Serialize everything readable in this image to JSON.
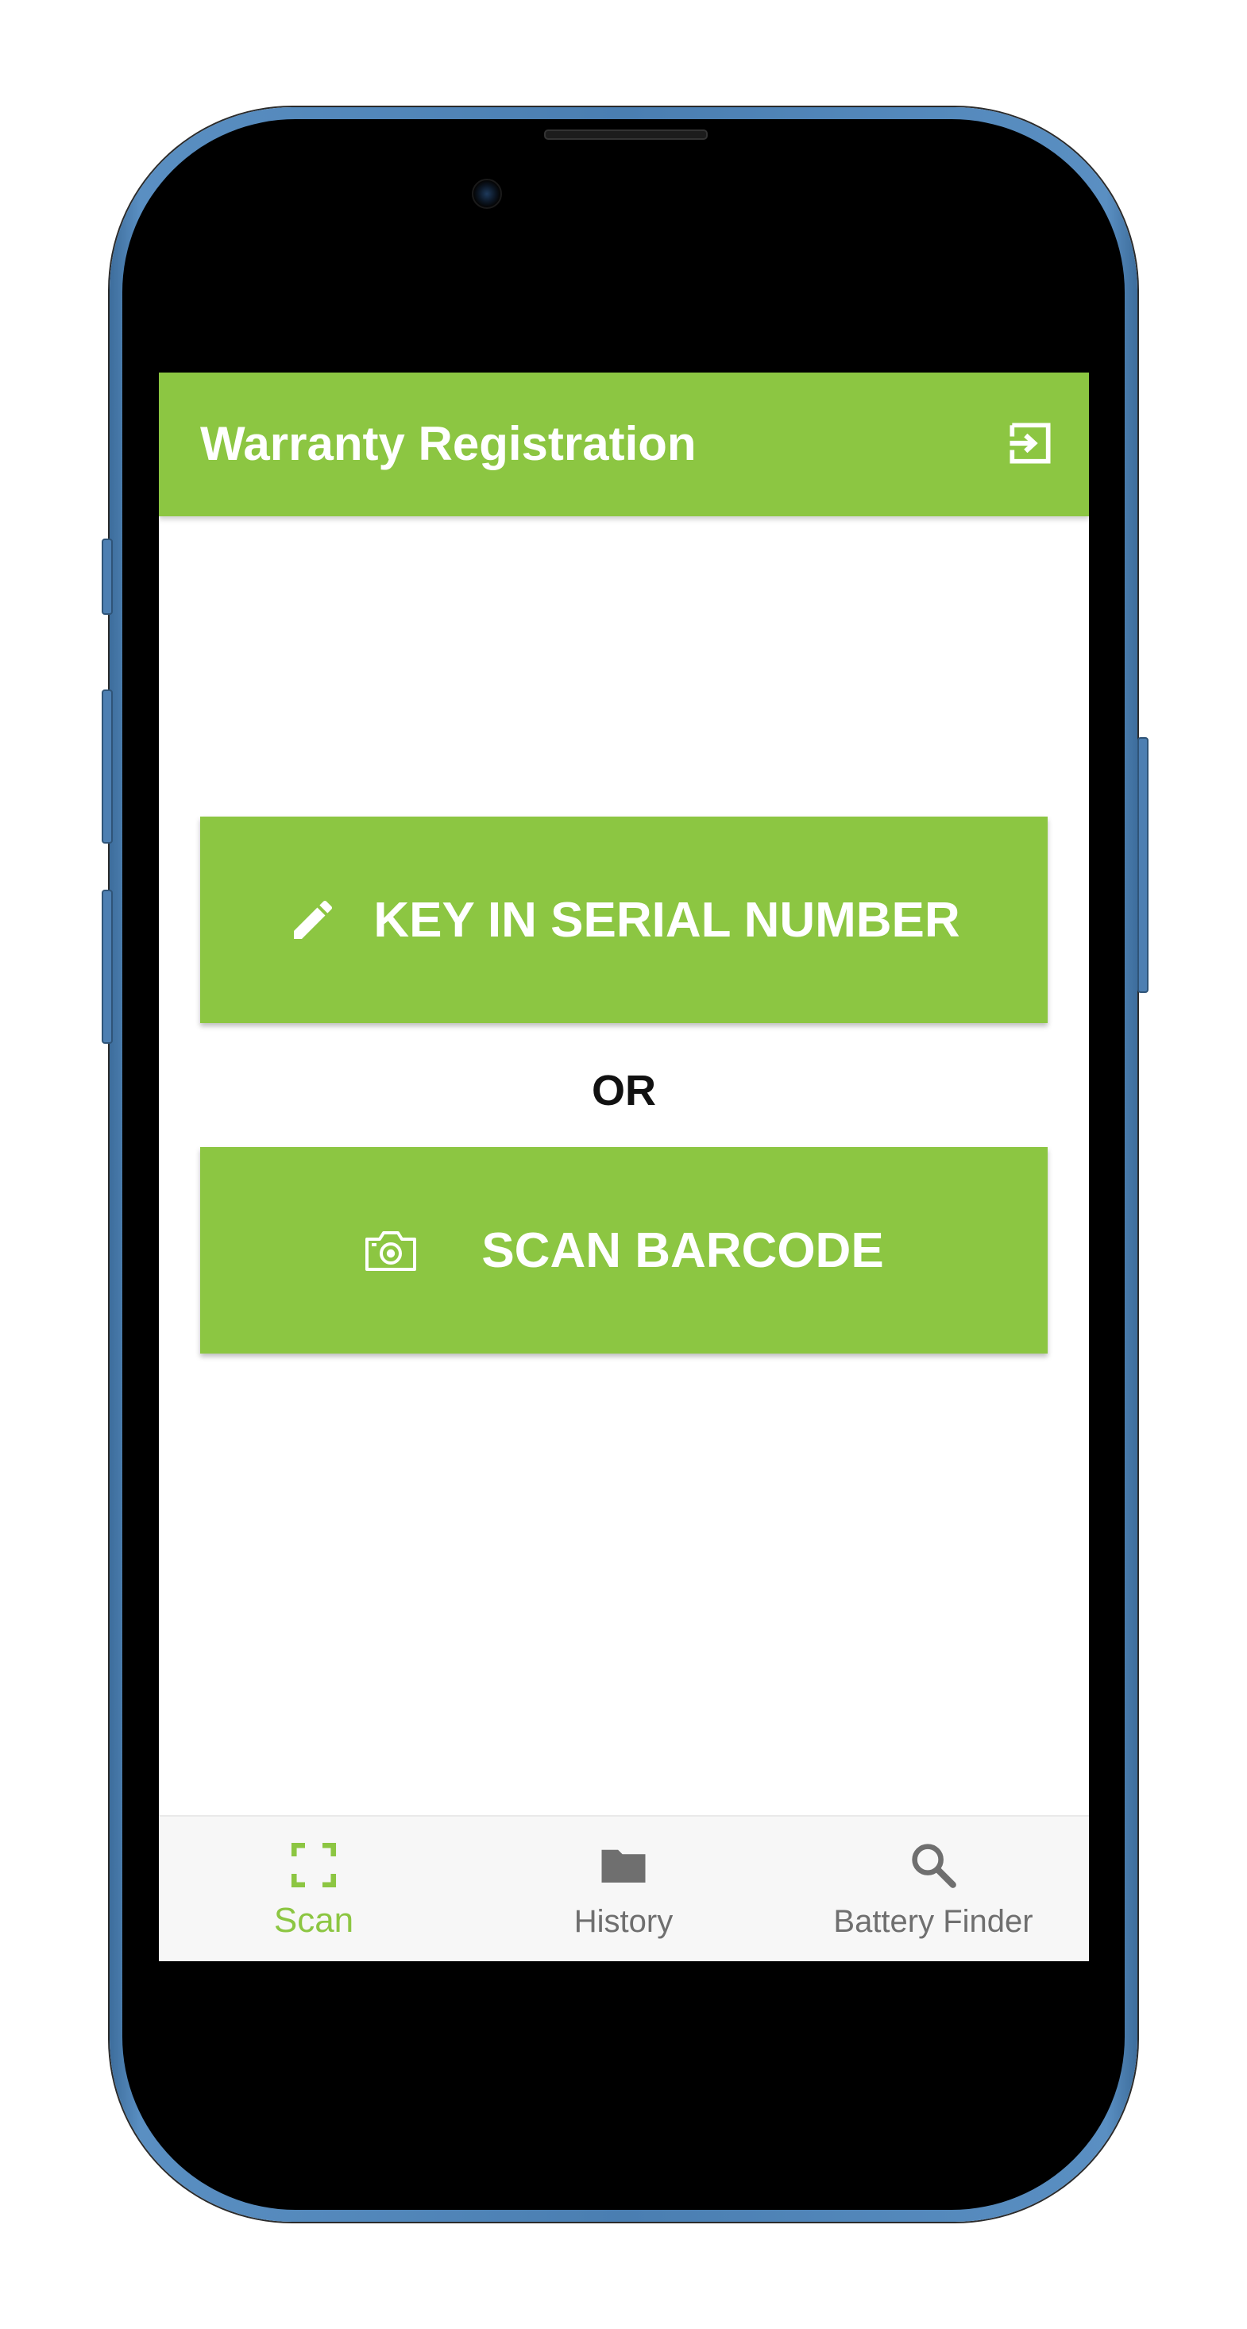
{
  "app_bar": {
    "title": "Warranty Registration",
    "logout_icon": "logout-icon"
  },
  "main": {
    "key_in_button": {
      "label": "KEY IN SERIAL NUMBER",
      "icon": "pencil-icon"
    },
    "or_text": "OR",
    "scan_button": {
      "label": "SCAN BARCODE",
      "icon": "camera-icon"
    }
  },
  "bottom_nav": {
    "items": [
      {
        "label": "Scan",
        "icon": "scan-frame-icon",
        "active": true
      },
      {
        "label": "History",
        "icon": "folder-icon",
        "active": false
      },
      {
        "label": "Battery Finder",
        "icon": "search-icon",
        "active": false
      }
    ]
  },
  "colors": {
    "brand_green": "#8cc642",
    "nav_inactive": "#6f6f6f",
    "phone_frame": "#4a7eb1"
  }
}
